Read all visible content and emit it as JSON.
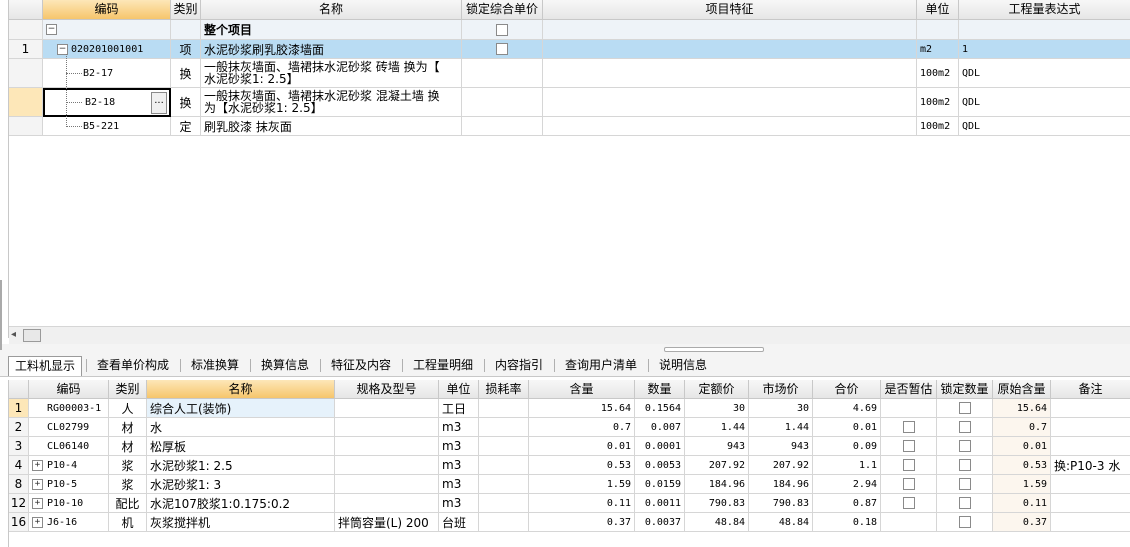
{
  "top_table": {
    "headers": {
      "code": "编码",
      "type": "类别",
      "name": "名称",
      "lock_price": "锁定综合单价",
      "feature": "项目特征",
      "unit": "单位",
      "expr": "工程量表达式"
    },
    "whole_project": {
      "label": "整个项目",
      "expand": "−"
    },
    "rows": [
      {
        "num": "1",
        "code": "020201001001",
        "type": "项",
        "name": "水泥砂浆刷乳胶漆墙面",
        "unit": "m2",
        "expr": "1",
        "expand": "−"
      },
      {
        "num": "",
        "code": "B2-17",
        "type": "换",
        "name_line1": "一般抹灰墙面、墙裙抹水泥砂浆 砖墙  换为【",
        "name_line2": "水泥砂浆1: 2.5】",
        "unit": "100m2",
        "expr": "QDL"
      },
      {
        "num": "",
        "code": "B2-18",
        "type": "换",
        "name_line1": "一般抹灰墙面、墙裙抹水泥砂浆 混凝土墙  换",
        "name_line2": "为【水泥砂浆1: 2.5】",
        "unit": "100m2",
        "expr": "QDL",
        "ellipsis": "···"
      },
      {
        "num": "",
        "code": "B5-221",
        "type": "定",
        "name": "刷乳胶漆 抹灰面",
        "unit": "100m2",
        "expr": "QDL"
      }
    ]
  },
  "scroll_left_arrow": "◂",
  "tabs": [
    "工料机显示",
    "查看单价构成",
    "标准换算",
    "换算信息",
    "特征及内容",
    "工程量明细",
    "内容指引",
    "查询用户清单",
    "说明信息"
  ],
  "bottom_table": {
    "headers": {
      "code": "编码",
      "type": "类别",
      "name": "名称",
      "spec": "规格及型号",
      "unit": "单位",
      "loss": "损耗率",
      "content": "含量",
      "qty": "数量",
      "quota_price": "定额价",
      "market_price": "市场价",
      "total": "合价",
      "provisional": "是否暂估",
      "lock_qty": "锁定数量",
      "orig_content": "原始含量",
      "note": "备注"
    },
    "rows": [
      {
        "num": "1",
        "exp": "",
        "code": "RG00003-1",
        "type": "人",
        "name": "综合人工(装饰)",
        "spec": "",
        "unit": "工日",
        "loss": "",
        "content": "15.64",
        "qty": "0.1564",
        "quota_price": "30",
        "market_price": "30",
        "total": "4.69",
        "provisional": false,
        "lock": true,
        "orig": "15.64",
        "note": ""
      },
      {
        "num": "2",
        "exp": "",
        "code": "CL02799",
        "type": "材",
        "name": "水",
        "spec": "",
        "unit": "m3",
        "loss": "",
        "content": "0.7",
        "qty": "0.007",
        "quota_price": "1.44",
        "market_price": "1.44",
        "total": "0.01",
        "provisional": true,
        "lock": true,
        "orig": "0.7",
        "note": ""
      },
      {
        "num": "3",
        "exp": "",
        "code": "CL06140",
        "type": "材",
        "name": "松厚板",
        "spec": "",
        "unit": "m3",
        "loss": "",
        "content": "0.01",
        "qty": "0.0001",
        "quota_price": "943",
        "market_price": "943",
        "total": "0.09",
        "provisional": true,
        "lock": true,
        "orig": "0.01",
        "note": ""
      },
      {
        "num": "4",
        "exp": "+",
        "code": "P10-4",
        "type": "浆",
        "name": "水泥砂浆1: 2.5",
        "spec": "",
        "unit": "m3",
        "loss": "",
        "content": "0.53",
        "qty": "0.0053",
        "quota_price": "207.92",
        "market_price": "207.92",
        "total": "1.1",
        "provisional": true,
        "lock": true,
        "orig": "0.53",
        "note": "换:P10-3 水"
      },
      {
        "num": "8",
        "exp": "+",
        "code": "P10-5",
        "type": "浆",
        "name": "水泥砂浆1: 3",
        "spec": "",
        "unit": "m3",
        "loss": "",
        "content": "1.59",
        "qty": "0.0159",
        "quota_price": "184.96",
        "market_price": "184.96",
        "total": "2.94",
        "provisional": true,
        "lock": true,
        "orig": "1.59",
        "note": ""
      },
      {
        "num": "12",
        "exp": "+",
        "code": "P10-10",
        "type": "配比",
        "name": "水泥107胶浆1:0.175:0.2",
        "spec": "",
        "unit": "m3",
        "loss": "",
        "content": "0.11",
        "qty": "0.0011",
        "quota_price": "790.83",
        "market_price": "790.83",
        "total": "0.87",
        "provisional": true,
        "lock": true,
        "orig": "0.11",
        "note": ""
      },
      {
        "num": "16",
        "exp": "+",
        "code": "J6-16",
        "type": "机",
        "name": "灰浆搅拌机",
        "spec": "拌筒容量(L) 200",
        "unit": "台班",
        "loss": "",
        "content": "0.37",
        "qty": "0.0037",
        "quota_price": "48.84",
        "market_price": "48.84",
        "total": "0.18",
        "provisional": false,
        "lock": true,
        "orig": "0.37",
        "note": ""
      }
    ]
  },
  "colors": {
    "selected_row": "#b9dcf3",
    "highlight_cell": "#e6f2fb",
    "orig_col": "#fcf6ee",
    "orange_header": "#f6c56c",
    "yellow_num": "#fde7b8"
  }
}
